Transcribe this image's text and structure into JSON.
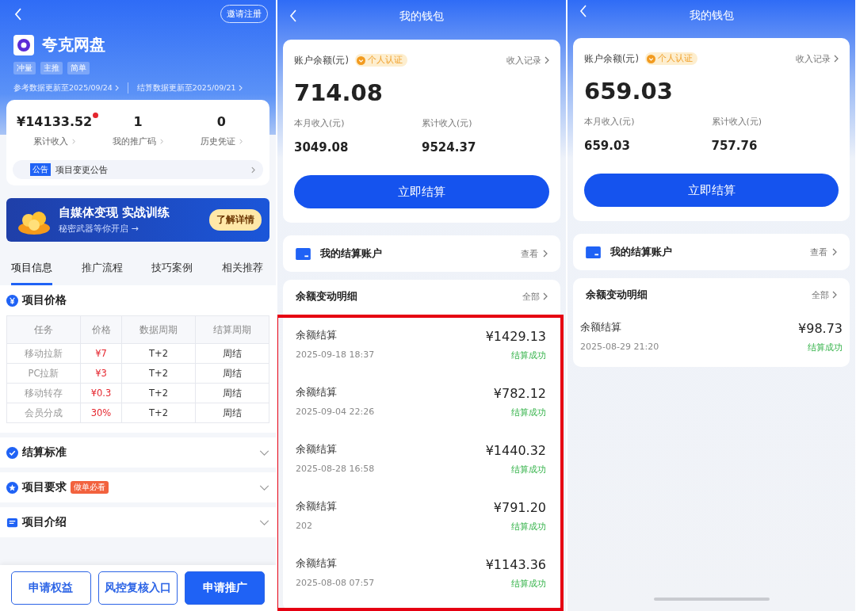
{
  "project_page": {
    "invite_button": "邀请注册",
    "app_name": "夸克网盘",
    "tags": [
      "冲量",
      "主推",
      "简单"
    ],
    "updates": [
      "参考数据更新至2025/09/24",
      "结算数据更新至2025/09/21"
    ],
    "stats": [
      {
        "value": "¥14133.52",
        "label": "累计收入",
        "notification_dot": true
      },
      {
        "value": "1",
        "label": "我的推广码",
        "notification_dot": false
      },
      {
        "value": "0",
        "label": "历史凭证",
        "notification_dot": false
      }
    ],
    "notice": {
      "tag": "公告",
      "text": "项目变更公告"
    },
    "banner": {
      "title": "自媒体变现 实战训练",
      "subtitle": "秘密武器等你开启 →",
      "button": "了解详情"
    },
    "tabs": [
      {
        "label": "项目信息",
        "selected": true
      },
      {
        "label": "推广流程",
        "selected": false
      },
      {
        "label": "技巧案例",
        "selected": false
      },
      {
        "label": "相关推荐",
        "selected": false
      }
    ],
    "price_section": {
      "title": "项目价格",
      "columns": [
        "任务",
        "价格",
        "数据周期",
        "结算周期"
      ],
      "rows": [
        [
          "移动拉新",
          "¥7",
          "T+2",
          "周结"
        ],
        [
          "PC拉新",
          "¥3",
          "T+2",
          "周结"
        ],
        [
          "移动转存",
          "¥0.3",
          "T+2",
          "周结"
        ],
        [
          "会员分成",
          "30%",
          "T+2",
          "周结"
        ]
      ]
    },
    "sections": [
      {
        "kind": "check",
        "title": "结算标准",
        "expanded": false
      },
      {
        "kind": "star",
        "title": "项目要求",
        "badge": "做单必看",
        "expanded": false
      },
      {
        "kind": "doc",
        "title": "项目介绍",
        "expanded": false
      }
    ],
    "bottom_buttons": [
      {
        "label": "申请权益",
        "primary": false
      },
      {
        "label": "风控复核入口",
        "primary": false
      },
      {
        "label": "申请推广",
        "primary": true
      }
    ]
  },
  "wallets": [
    {
      "title": "我的钱包",
      "balance_label": "账户余额(元)",
      "badge": "个人认证",
      "income_link": "收入记录",
      "balance": "714.08",
      "stats": [
        {
          "label": "本月收入(元)",
          "value": "3049.08"
        },
        {
          "label": "累计收入(元)",
          "value": "9524.37"
        }
      ],
      "settle_button": "立即结算",
      "account": {
        "title": "我的结算账户",
        "link": "查看"
      },
      "records_title": "余额变动明细",
      "records_link": "全部",
      "highlighted": true,
      "home_indicator": false,
      "records": [
        {
          "title": "余额结算",
          "amount": "¥1429.13",
          "time": "2025-09-18 18:37",
          "status": "结算成功"
        },
        {
          "title": "余额结算",
          "amount": "¥782.12",
          "time": "2025-09-04 22:26",
          "status": "结算成功"
        },
        {
          "title": "余额结算",
          "amount": "¥1440.32",
          "time": "2025-08-28 16:58",
          "status": "结算成功"
        },
        {
          "title": "余额结算",
          "amount": "¥791.20",
          "time": "202",
          "status": "结算成功"
        },
        {
          "title": "余额结算",
          "amount": "¥1143.36",
          "time": "2025-08-08 07:57",
          "status": "结算成功"
        }
      ]
    },
    {
      "title": "我的钱包",
      "balance_label": "账户余额(元)",
      "badge": "个人认证",
      "income_link": "收入记录",
      "balance": "659.03",
      "stats": [
        {
          "label": "本月收入(元)",
          "value": "659.03"
        },
        {
          "label": "累计收入(元)",
          "value": "757.76"
        }
      ],
      "settle_button": "立即结算",
      "account": {
        "title": "我的结算账户",
        "link": "查看"
      },
      "records_title": "余额变动明细",
      "records_link": "全部",
      "highlighted": false,
      "home_indicator": true,
      "records": [
        {
          "title": "余额结算",
          "amount": "¥98.73",
          "time": "2025-08-29 21:20",
          "status": "结算成功"
        }
      ]
    }
  ]
}
